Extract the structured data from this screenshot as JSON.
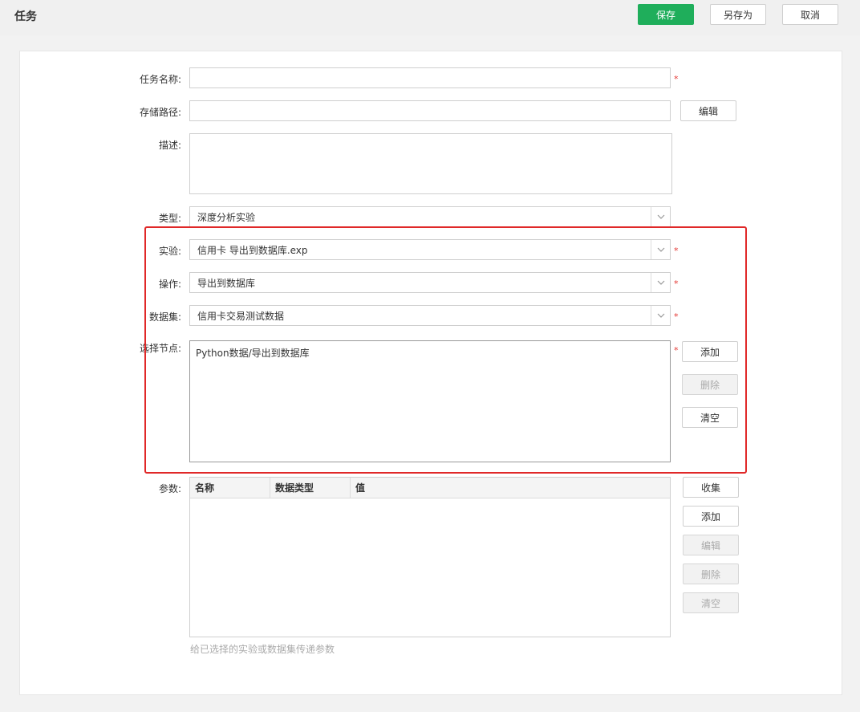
{
  "header": {
    "title": "任务",
    "save_label": "保存",
    "save_as_label": "另存为",
    "cancel_label": "取消"
  },
  "colors": {
    "primary": "#1fae5b",
    "required": "#e53935",
    "highlight": "#e02828"
  },
  "form": {
    "task_name": {
      "label": "任务名称:",
      "value": ""
    },
    "storage_path": {
      "label": "存储路径:",
      "value": "",
      "edit_label": "编辑"
    },
    "description": {
      "label": "描述:",
      "value": ""
    },
    "type": {
      "label": "类型:",
      "value": "深度分析实验"
    },
    "experiment": {
      "label": "实验:",
      "value": "信用卡 导出到数据库.exp"
    },
    "operation": {
      "label": "操作:",
      "value": "导出到数据库"
    },
    "dataset": {
      "label": "数据集:",
      "value": "信用卡交易测试数据"
    },
    "nodes": {
      "label": "选择节点:",
      "items": [
        "Python数据/导出到数据库"
      ],
      "add_label": "添加",
      "delete_label": "删除",
      "clear_label": "清空"
    },
    "params": {
      "label": "参数:",
      "columns": [
        "名称",
        "数据类型",
        "值"
      ],
      "collect_label": "收集",
      "add_label": "添加",
      "edit_label": "编辑",
      "delete_label": "删除",
      "clear_label": "清空",
      "hint": "给已选择的实验或数据集传递参数"
    },
    "required_mark": "*"
  }
}
